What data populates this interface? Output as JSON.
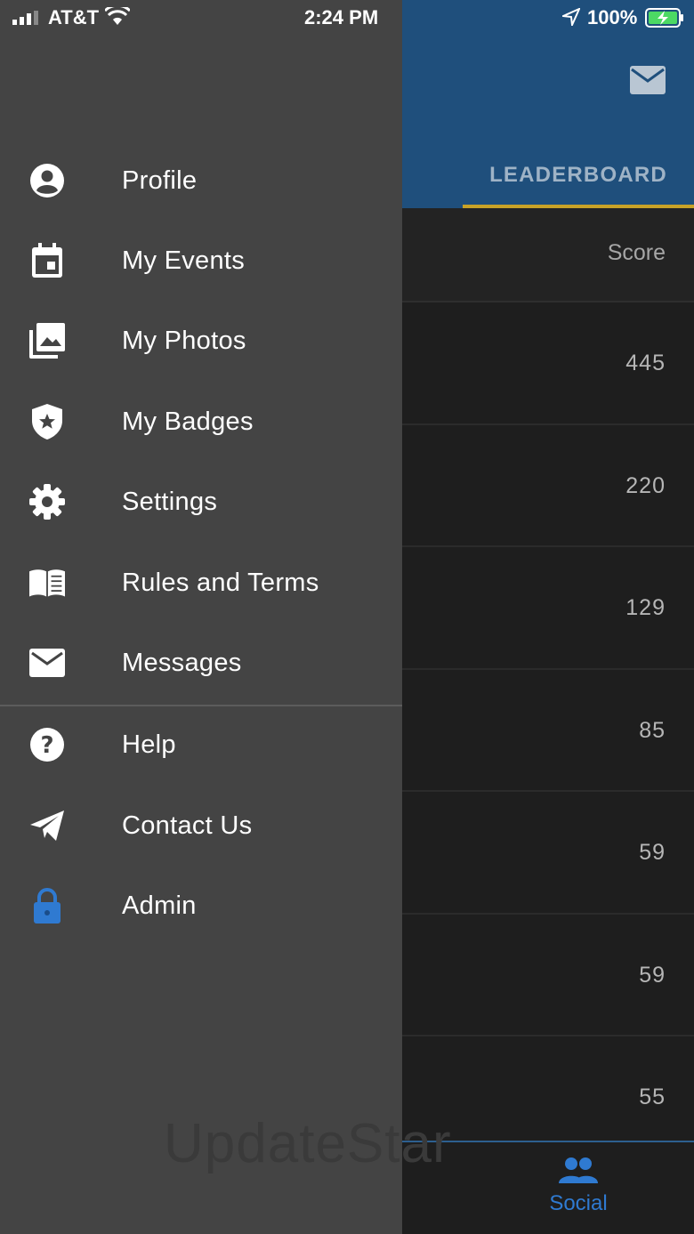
{
  "status_bar": {
    "carrier": "AT&T",
    "time": "2:24 PM",
    "battery": "100%"
  },
  "header": {
    "tab_label": "LEADERBOARD",
    "mail_icon": "mail-icon"
  },
  "leaderboard": {
    "score_header": "Score",
    "scores": [
      "445",
      "220",
      "129",
      "85",
      "59",
      "59",
      "55"
    ]
  },
  "bottom_nav": {
    "social_label": "Social",
    "social_icon": "people-icon"
  },
  "drawer": {
    "items": [
      {
        "label": "Profile",
        "icon": "account-circle-icon"
      },
      {
        "label": "My Events",
        "icon": "calendar-icon"
      },
      {
        "label": "My Photos",
        "icon": "photo-library-icon"
      },
      {
        "label": "My Badges",
        "icon": "shield-star-icon"
      },
      {
        "label": "Settings",
        "icon": "gear-icon"
      },
      {
        "label": "Rules and Terms",
        "icon": "book-icon"
      },
      {
        "label": "Messages",
        "icon": "mail-icon"
      },
      {
        "label": "Help",
        "icon": "help-circle-icon"
      },
      {
        "label": "Contact Us",
        "icon": "send-icon"
      },
      {
        "label": "Admin",
        "icon": "lock-icon"
      }
    ]
  },
  "watermark": "UpdateStar",
  "colors": {
    "drawer_bg": "#444444",
    "header_bg": "#1f4f7c",
    "tab_underline": "#c8a227",
    "accent_blue": "#2f7ad1"
  }
}
